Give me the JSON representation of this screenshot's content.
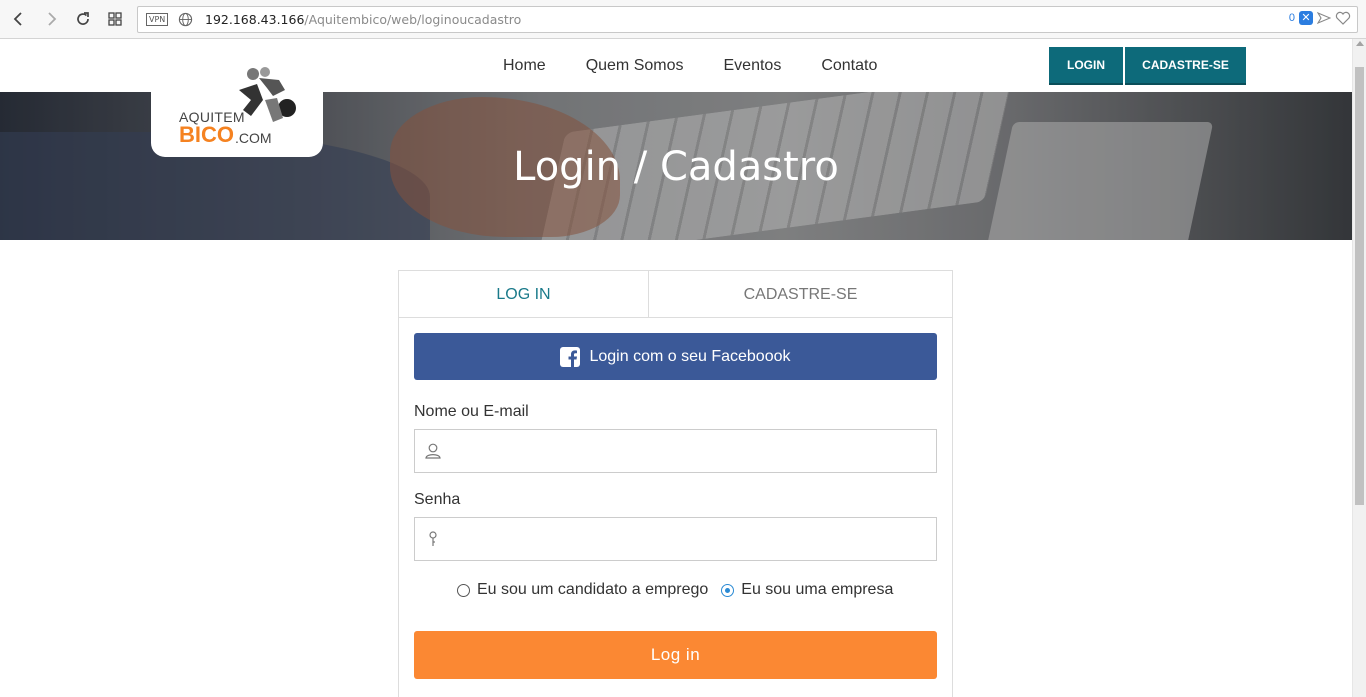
{
  "browser": {
    "vpn_label": "VPN",
    "url_host": "192.168.43.166",
    "url_path": "/Aquitembico/web/loginoucadastro",
    "badge_count": "0"
  },
  "site": {
    "logo": {
      "line1": "AQUITEM",
      "line2": "BICO",
      "line3": ".COM"
    },
    "menu": [
      {
        "label": "Home"
      },
      {
        "label": "Quem Somos"
      },
      {
        "label": "Eventos"
      },
      {
        "label": "Contato"
      }
    ],
    "login_button": "LOGIN",
    "signup_button": "CADASTRE-SE"
  },
  "hero": {
    "title": "Login / Cadastro"
  },
  "form": {
    "tabs": [
      {
        "label": "LOG IN",
        "active": true
      },
      {
        "label": "CADASTRE-SE",
        "active": false
      }
    ],
    "facebook_button": "Login com o seu Faceboook",
    "name_label": "Nome ou E-mail",
    "name_value": "",
    "password_label": "Senha",
    "password_value": "",
    "radio_options": [
      {
        "label": "Eu sou um candidato a emprego",
        "checked": false
      },
      {
        "label": "Eu sou uma empresa",
        "checked": true
      }
    ],
    "submit_button": "Log in"
  },
  "colors": {
    "teal": "#0d6a7a",
    "facebook": "#3b5998",
    "orange": "#fb8833",
    "radio_accent": "#2a8ad4"
  }
}
